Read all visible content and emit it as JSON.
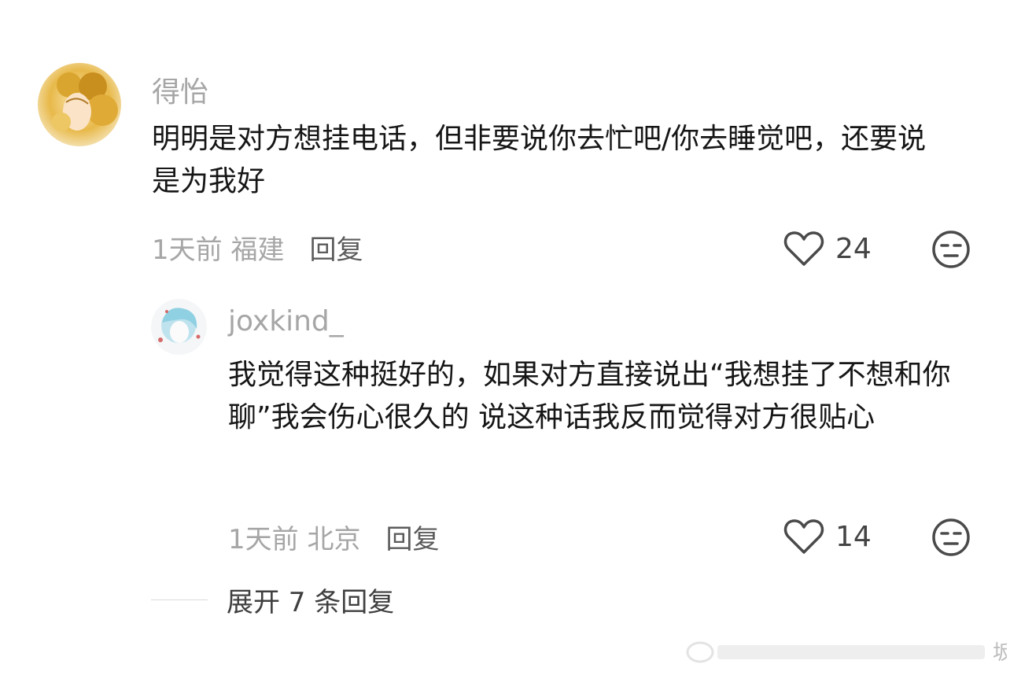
{
  "comments": [
    {
      "username": "得怡",
      "text": "明明是对方想挂电话，但非要说你去忙吧/你去睡觉吧，还要说是为我好",
      "time_location": "1天前 福建",
      "reply_label": "回复",
      "likes": "24"
    }
  ],
  "replies": [
    {
      "username": "joxkind_",
      "text": "我觉得这种挺好的，如果对方直接说出“我想挂了不想和你聊”我会伤心很久的 说这种话我反而觉得对方很贴心",
      "time_location": "1天前 北京",
      "reply_label": "回复",
      "likes": "14"
    }
  ],
  "expand_label": "展开 7 条回复",
  "colors": {
    "meta_gray": "#a6a6a6",
    "text_dark": "#161616",
    "icon_gray": "#4a4a4a"
  },
  "icons": {
    "like": "heart-outline-icon",
    "dislike": "neutral-face-icon"
  }
}
